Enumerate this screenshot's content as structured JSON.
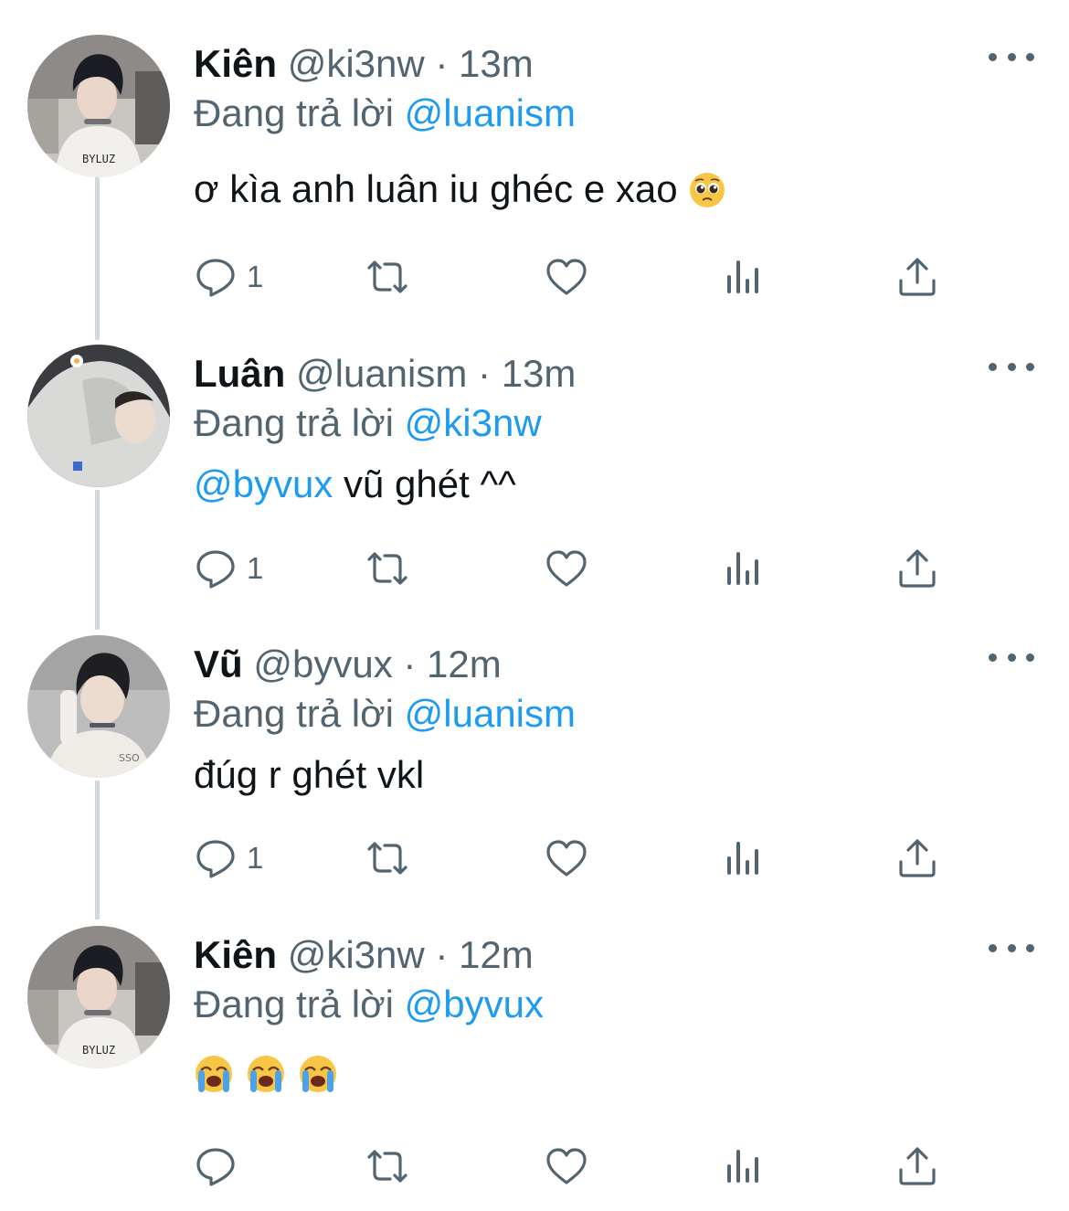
{
  "labels": {
    "replying_prefix": "Đang trả lời"
  },
  "colors": {
    "text": "#0f1419",
    "secondary": "#536471",
    "link": "#1d9bf0",
    "thread_line": "#cfd9de"
  },
  "icons": {
    "more": "more-horizontal-icon",
    "reply": "reply-bubble-icon",
    "retweet": "retweet-icon",
    "like": "heart-icon",
    "analytics": "bar-chart-icon",
    "share": "share-upload-icon"
  },
  "tweets": [
    {
      "name": "Kiên",
      "handle": "@ki3nw",
      "separator": "·",
      "time": "13m",
      "replying_to": "@luanism",
      "text": "ơ kìa anh luân iu ghéc e xao",
      "emoji": "pleading-face",
      "mention": "",
      "reply_count": "1"
    },
    {
      "name": "Luân",
      "handle": "@luanism",
      "separator": "·",
      "time": "13m",
      "replying_to": "@ki3nw",
      "mention": "@byvux",
      "text": " vũ ghét ^^",
      "reply_count": "1"
    },
    {
      "name": "Vũ",
      "handle": "@byvux",
      "separator": "·",
      "time": "12m",
      "replying_to": "@luanism",
      "text": "đúg r ghét vkl",
      "mention": "",
      "reply_count": "1"
    },
    {
      "name": "Kiên",
      "handle": "@ki3nw",
      "separator": "·",
      "time": "12m",
      "replying_to": "@byvux",
      "text": "",
      "mention": "",
      "emoji": "loudly-crying-face ×3",
      "reply_count": ""
    }
  ]
}
